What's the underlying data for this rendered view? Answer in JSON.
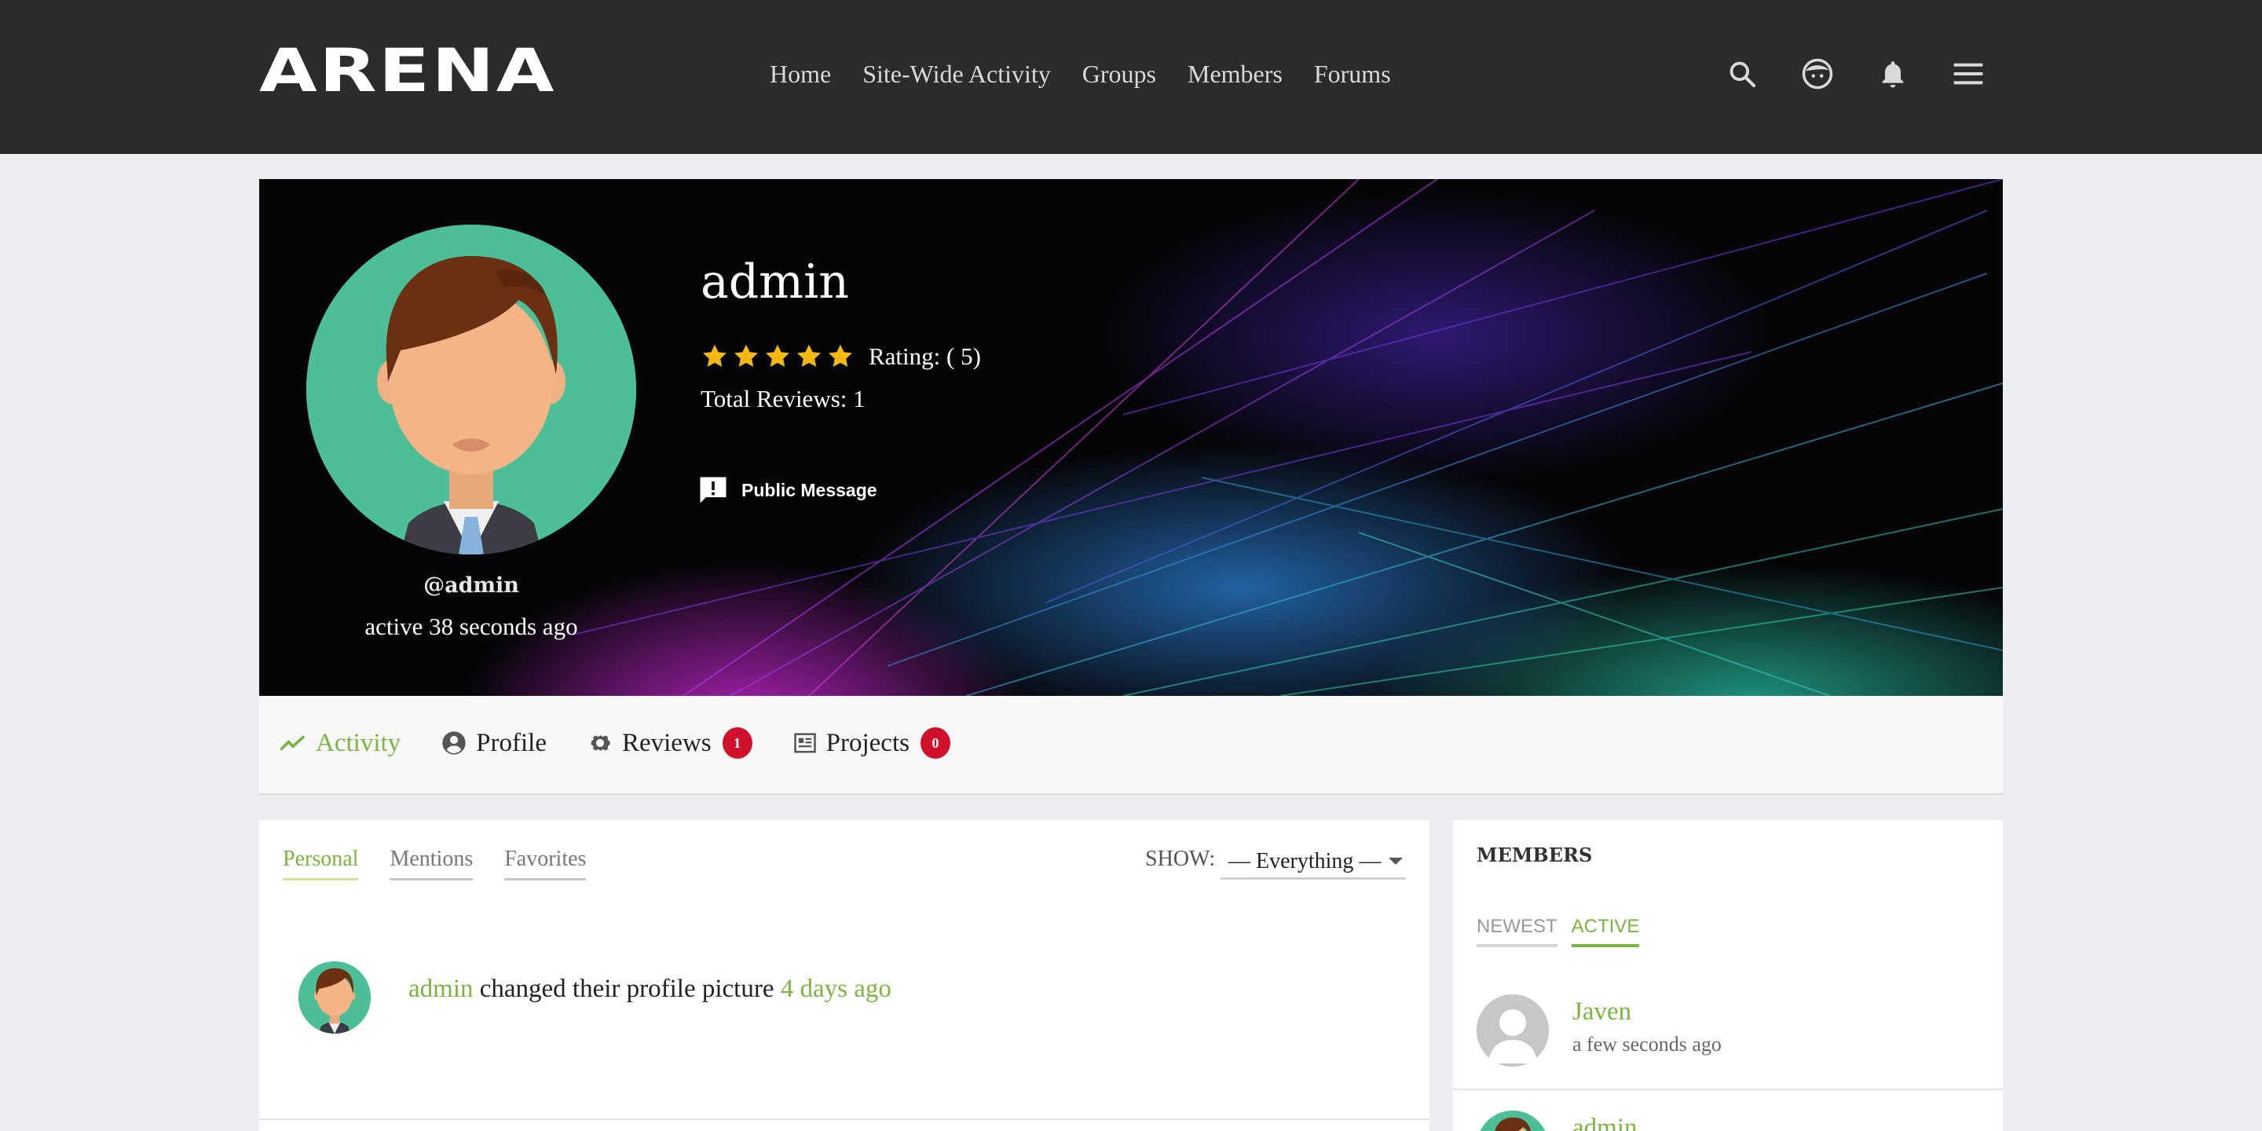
{
  "header": {
    "logo_text": "ARENA",
    "nav": [
      "Home",
      "Site-Wide Activity",
      "Groups",
      "Members",
      "Forums"
    ],
    "icons": [
      "search-icon",
      "user-face-icon",
      "bell-icon",
      "menu-icon"
    ]
  },
  "profile": {
    "name": "admin",
    "handle": "@admin",
    "last_active": "active 38 seconds ago",
    "rating_label": "Rating: ( 5)",
    "rating_stars": 5,
    "total_reviews": "Total Reviews: 1",
    "public_message_label": "Public Message"
  },
  "tabs": [
    {
      "label": "Activity",
      "active": true
    },
    {
      "label": "Profile"
    },
    {
      "label": "Reviews",
      "badge": "1"
    },
    {
      "label": "Projects",
      "badge": "0"
    }
  ],
  "activity": {
    "subtabs": [
      "Personal",
      "Mentions",
      "Favorites"
    ],
    "show_label": "SHOW:",
    "show_value": "— Everything —",
    "item": {
      "actor": "admin",
      "action": " changed their profile picture ",
      "time": "4 days ago"
    }
  },
  "members_widget": {
    "title": "MEMBERS",
    "tabs": [
      "NEWEST",
      "ACTIVE"
    ],
    "member": {
      "name": "Javen",
      "time": "a few seconds ago"
    },
    "member2": {
      "name": "admin"
    }
  },
  "colors": {
    "accent": "#7cb442",
    "header_bg": "#2b2b2b",
    "badge": "#d0112b",
    "star": "#f6b80f",
    "avatar_bg": "#4cbf97"
  }
}
